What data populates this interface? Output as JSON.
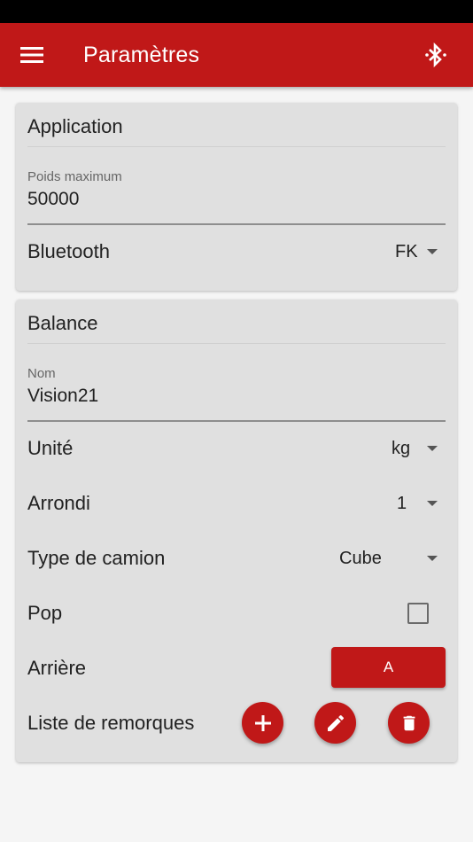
{
  "app_bar": {
    "title": "Paramètres",
    "menu_icon": "menu-icon",
    "bluetooth_icon": "bluetooth-icon"
  },
  "application": {
    "title": "Application",
    "max_weight": {
      "label": "Poids maximum",
      "value": "50000"
    },
    "bluetooth": {
      "label": "Bluetooth",
      "value": "FK"
    }
  },
  "balance": {
    "title": "Balance",
    "name": {
      "label": "Nom",
      "value": "Vision21"
    },
    "unit": {
      "label": "Unité",
      "value": "kg"
    },
    "rounding": {
      "label": "Arrondi",
      "value": "1"
    },
    "truck_type": {
      "label": "Type de camion",
      "value": "Cube"
    },
    "pop": {
      "label": "Pop",
      "checked": false
    },
    "rear": {
      "label": "Arrière",
      "button": "A"
    },
    "trailers": {
      "label": "Liste de remorques",
      "icons": [
        "add-icon",
        "edit-icon",
        "delete-icon"
      ]
    }
  },
  "colors": {
    "primary": "#c01818",
    "card": "#e0e0e0",
    "background": "#f5f5f5"
  }
}
